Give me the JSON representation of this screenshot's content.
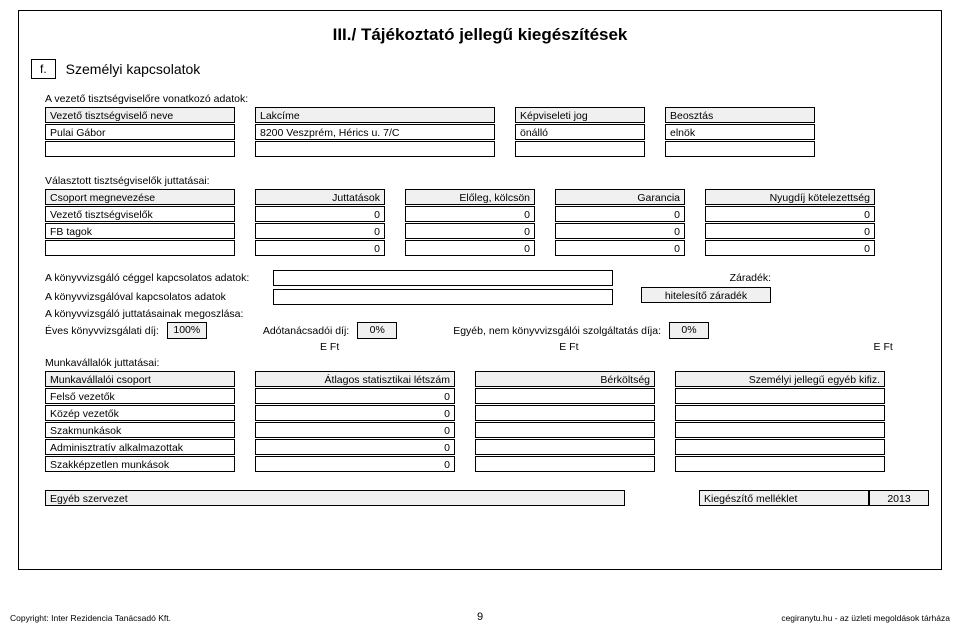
{
  "title": "III./ Tájékoztató jellegű kiegészítések",
  "section": {
    "letter": "f.",
    "heading": "Személyi kapcsolatok"
  },
  "leader_intro": "A vezető tisztségviselőre vonatkozó adatok:",
  "tableA": {
    "headers": {
      "name": "Vezető tisztségviselő neve",
      "addr": "Lakcíme",
      "rep": "Képviseleti jog",
      "pos": "Beosztás"
    },
    "row": {
      "name": "Pulai Gábor",
      "addr": "8200 Veszprém, Hérics u. 7/C",
      "rep": "önálló",
      "pos": "elnök"
    }
  },
  "elected_intro": "Választott tisztségviselők juttatásai:",
  "tableB": {
    "headers": {
      "group": "Csoport megnevezése",
      "jut": "Juttatások",
      "loan": "Előleg, kölcsön",
      "gar": "Garancia",
      "pension": "Nyugdíj kötelezettség"
    },
    "rows": [
      {
        "g": "Vezető tisztségviselők",
        "v": [
          "0",
          "0",
          "0",
          "0"
        ]
      },
      {
        "g": "FB tagok",
        "v": [
          "0",
          "0",
          "0",
          "0"
        ]
      },
      {
        "g": "",
        "v": [
          "0",
          "0",
          "0",
          "0"
        ]
      }
    ]
  },
  "auditor_block": {
    "line1": "A könyvvizsgáló céggel kapcsolatos adatok:",
    "line2": "A könyvvizsgálóval kapcsolatos adatok",
    "zaradek_lab": "Záradék:",
    "zaradek_val": "hitelesítő záradék",
    "line3": "A könyvvizsgáló juttatásainak megoszlása:",
    "fees": {
      "annual_lab": "Éves könyvvizsgálati díj:",
      "annual_val": "100%",
      "tax_lab": "Adótanácsadói díj:",
      "tax_val": "0%",
      "other_lab": "Egyéb, nem könyvvizsgálói szolgáltatás díja:",
      "other_val": "0%"
    },
    "eft": "E Ft"
  },
  "emp_intro": "Munkavállalók juttatásai:",
  "tableC": {
    "headers": {
      "group": "Munkavállalói csoport",
      "avg": "Átlagos statisztikai létszám",
      "wage": "Bérköltség",
      "other": "Személyi jellegű egyéb kifiz."
    },
    "rows": [
      {
        "g": "Felső vezetők",
        "avg": "0"
      },
      {
        "g": "Közép vezetők",
        "avg": "0"
      },
      {
        "g": "Szakmunkások",
        "avg": "0"
      },
      {
        "g": "Adminisztratív alkalmazottak",
        "avg": "0"
      },
      {
        "g": "Szakképzetlen munkások",
        "avg": "0"
      }
    ]
  },
  "egyeb": {
    "title": "Egyéb szervezet",
    "attach": "Kiegészítő melléklet",
    "year": "2013"
  },
  "footer": {
    "left": "Copyright: Inter Rezidencia Tanácsadó Kft.",
    "page": "9",
    "right": "cegiranytu.hu - az üzleti megoldások tárháza"
  }
}
